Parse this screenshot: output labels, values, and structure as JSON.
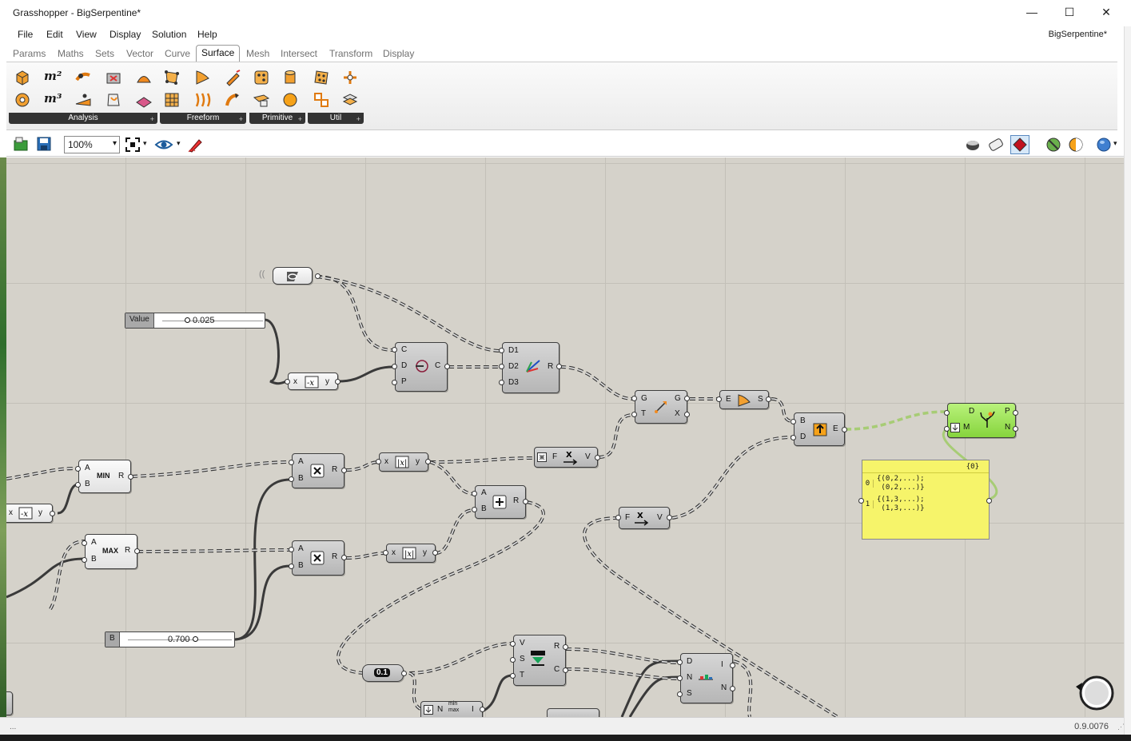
{
  "window": {
    "title": "Grasshopper - BigSerpentine*",
    "minimize": "—",
    "maximize": "☐",
    "close": "✕"
  },
  "menu": {
    "items": [
      "File",
      "Edit",
      "View",
      "Display",
      "Solution",
      "Help"
    ],
    "document": "BigSerpentine*"
  },
  "tabs": [
    "Params",
    "Maths",
    "Sets",
    "Vector",
    "Curve",
    "Surface",
    "Mesh",
    "Intersect",
    "Transform",
    "Display"
  ],
  "active_tab": "Surface",
  "ribbon": {
    "panels": [
      {
        "label": "Analysis",
        "expand": "+",
        "glyphs": [
          "m²",
          "m³"
        ]
      },
      {
        "label": "Freeform",
        "expand": "+"
      },
      {
        "label": "Primitive",
        "expand": "+"
      },
      {
        "label": "Util",
        "expand": "+"
      }
    ]
  },
  "toolbar": {
    "zoom": "100%",
    "zoom_caret": "▾"
  },
  "canvas": {
    "sliders": [
      {
        "name": "Value",
        "value": "0.025"
      },
      {
        "name": "B",
        "value": "0.700"
      }
    ],
    "components": {
      "negative_top": {
        "in": "x",
        "out": "y"
      },
      "negative_left": {
        "in": "x",
        "out": "y"
      },
      "circle": {
        "inputs": [
          "C",
          "D",
          "P"
        ],
        "outputs": [
          "C"
        ]
      },
      "divide": {
        "inputs": [
          "D1",
          "D2",
          "D3"
        ],
        "outputs": [
          "R"
        ]
      },
      "move": {
        "inputs": [
          "G",
          "T"
        ],
        "outputs": [
          "G",
          "X"
        ]
      },
      "extrude": {
        "inputs": [
          "E"
        ],
        "outputs": [
          "S"
        ]
      },
      "boundary": {
        "inputs": [
          "B",
          "D"
        ],
        "outputs": [
          "E"
        ]
      },
      "graft": {
        "inputs": [
          "D",
          "M"
        ],
        "outputs": [
          "P",
          "N"
        ]
      },
      "min": {
        "inputs": [
          "A",
          "B"
        ],
        "outputs": [
          "R"
        ],
        "text": "MIN"
      },
      "max": {
        "inputs": [
          "A",
          "B"
        ],
        "outputs": [
          "R"
        ],
        "text": "MAX"
      },
      "mult1": {
        "inputs": [
          "A",
          "B"
        ],
        "outputs": [
          "R"
        ]
      },
      "mult2": {
        "inputs": [
          "A",
          "B"
        ],
        "outputs": [
          "R"
        ]
      },
      "abs1": {
        "in": "x",
        "out": "y"
      },
      "abs2": {
        "in": "x",
        "out": "y"
      },
      "add": {
        "inputs": [
          "A",
          "B"
        ],
        "outputs": [
          "R"
        ]
      },
      "vec1": {
        "inputs": [
          "F"
        ],
        "outputs": [
          "V"
        ]
      },
      "vec2": {
        "inputs": [
          "F"
        ],
        "outputs": [
          "V"
        ]
      },
      "graph": {
        "inputs": [
          "V",
          "S",
          "T"
        ],
        "outputs": [
          "R",
          "C"
        ]
      },
      "split": {
        "inputs": [
          "D",
          "N",
          "S"
        ],
        "outputs": [
          "I",
          "N"
        ]
      },
      "minmax": {
        "inputs": [
          "N"
        ],
        "outputs": [
          "I"
        ],
        "text": "min max"
      },
      "num_param": {
        "text": "0.1"
      }
    },
    "panel": {
      "header": "{0}",
      "rows": [
        {
          "index": "0",
          "lines": [
            "{(0,2,...);",
            " (0,2,...)}"
          ]
        },
        {
          "index": "1",
          "lines": [
            "{(1,3,...);",
            " (1,3,...)}"
          ]
        }
      ]
    }
  },
  "status": {
    "version": "0.9.0076"
  },
  "colors": {
    "canvas": "#d5d2ca",
    "grid": "#c3c0b8",
    "component": "#c4c4c4",
    "selected": "#8fdc4a",
    "panel": "#f6f46a"
  }
}
